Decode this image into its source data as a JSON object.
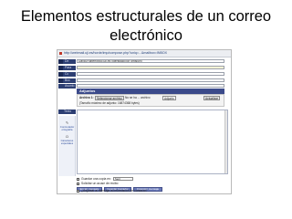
{
  "slide": {
    "title_line1": "Elementos estructurales de un correo",
    "title_line2": "electrónico"
  },
  "browser": {
    "url": "http://webmail.uji.es/horde/imp/compose.php?uniq=...&mailbox=INBOX"
  },
  "compose": {
    "from_label": "De",
    "from_value": "David.Robert@icc.uji.es [Identidad por omisión]",
    "to_label": "Para",
    "cc_label": "Cc",
    "bcc_label": "Bcc",
    "subject_label": "Asunto",
    "attachments_header": "Adjuntos",
    "attachment_label": "Archivo 1:",
    "browse_button": "Seleccionar archivo",
    "no_file_text": "No se ha ... archivo",
    "disposition_select": "Adjunto",
    "attach_button": "Actualizar",
    "max_size_text": "(Tamaño máximo de adjunto: 16874368 bytes)",
    "body_label": "Texto",
    "side_link_1": "Conmutador ortografía",
    "side_link_2": "Caracteres especiales",
    "save_copy_label": "Guardar una copia en:",
    "save_copy_folder": "Sent",
    "request_receipt_label": "Solicitar un acuse de recibo",
    "send_button": "Enviar mensaje",
    "draft_button": "Guardar borrador",
    "cancel_button": "Cancelar mensaje",
    "show_headers_label": "¿Adjuntar al mensaje la información de contacto?"
  }
}
